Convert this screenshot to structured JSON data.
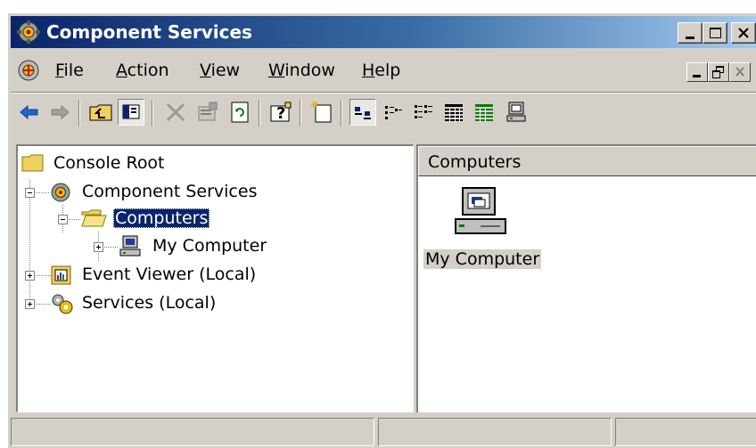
{
  "window": {
    "title": "Component Services",
    "title_bar_gradient": [
      "#0a246a",
      "#a6caf0"
    ],
    "caption_buttons": [
      "minimize-icon",
      "maximize-icon",
      "close-icon"
    ]
  },
  "menu": {
    "items": [
      {
        "label_first": "F",
        "label_rest": "ile"
      },
      {
        "label_first": "A",
        "label_rest": "ction"
      },
      {
        "label_first": "V",
        "label_rest": "iew"
      },
      {
        "label_first": "W",
        "label_rest": "indow"
      },
      {
        "label_first": "H",
        "label_rest": "elp"
      }
    ],
    "mdi_buttons": [
      "minimize-icon",
      "restore-icon",
      "close-icon"
    ]
  },
  "toolbar": {
    "buttons": [
      "back-icon",
      "forward-icon",
      "up-one-level-icon",
      "show-hide-tree-icon",
      "delete-icon",
      "properties-icon",
      "refresh-icon",
      "help-icon",
      "new-window-icon",
      "large-icons-icon",
      "small-icons-icon",
      "list-icon",
      "detail-icon",
      "filter-icon",
      "computer-icon"
    ]
  },
  "tree": {
    "root": "Console Root",
    "nodes": [
      {
        "label": "Component Services",
        "expander": "minus"
      },
      {
        "label": "Computers",
        "expander": "minus",
        "selected": true
      },
      {
        "label": "My Computer",
        "expander": "plus"
      },
      {
        "label": "Event Viewer (Local)",
        "expander": "plus"
      },
      {
        "label": "Services (Local)",
        "expander": "plus"
      }
    ]
  },
  "list": {
    "header": "Computers",
    "items": [
      {
        "label": "My Computer",
        "icon": "computer-icon"
      }
    ]
  },
  "colors": {
    "face": "#d4d0c8",
    "selection": "#0a246a",
    "shadow": "#808080"
  }
}
